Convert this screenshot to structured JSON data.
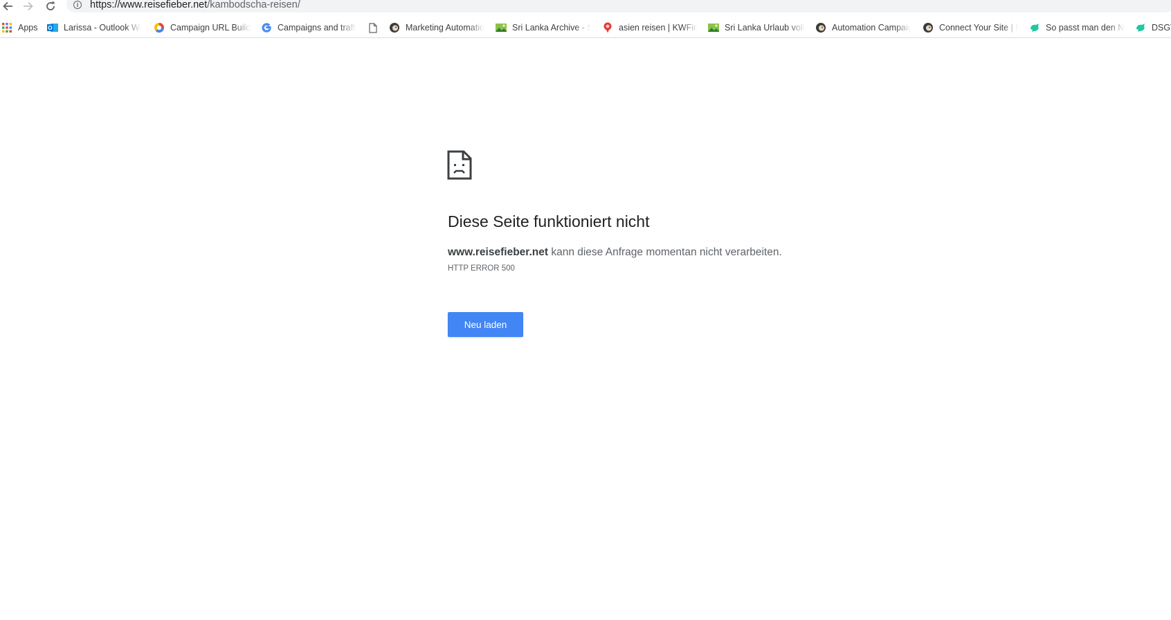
{
  "browser": {
    "url_host": "https://www.reisefieber.net",
    "url_path": "/kambodscha-reisen/"
  },
  "bookmarks": [
    {
      "label": "Apps",
      "icon": "apps-grid-icon"
    },
    {
      "label": "Larissa - Outlook Web",
      "icon": "outlook-icon"
    },
    {
      "label": "Campaign URL Builder",
      "icon": "campaign-url-builder-icon"
    },
    {
      "label": "Campaigns and traffic",
      "icon": "google-icon"
    },
    {
      "label": "",
      "icon": "page-icon"
    },
    {
      "label": "Marketing Automation",
      "icon": "mailchimp-icon"
    },
    {
      "label": "Sri Lanka Archive - Se",
      "icon": "image-icon"
    },
    {
      "label": "asien reisen | KWFinder",
      "icon": "kwfinder-icon"
    },
    {
      "label": "Sri Lanka Urlaub volle",
      "icon": "image-icon"
    },
    {
      "label": "Automation Campaign",
      "icon": "mailchimp-icon"
    },
    {
      "label": "Connect Your Site | M",
      "icon": "mailchimp-icon"
    },
    {
      "label": "So passt man den Ne",
      "icon": "cleverreach-icon"
    },
    {
      "label": "DSGV",
      "icon": "cleverreach-icon"
    }
  ],
  "error_page": {
    "icon": "sad-page-icon",
    "title": "Diese Seite funktioniert nicht",
    "host": "www.reisefieber.net",
    "message": " kann diese Anfrage momentan nicht verarbeiten.",
    "code": "HTTP ERROR 500",
    "reload_label": "Neu laden"
  },
  "colors": {
    "button_blue": "#4285f4",
    "text_dark": "#202124",
    "text_muted": "#5f6368"
  }
}
